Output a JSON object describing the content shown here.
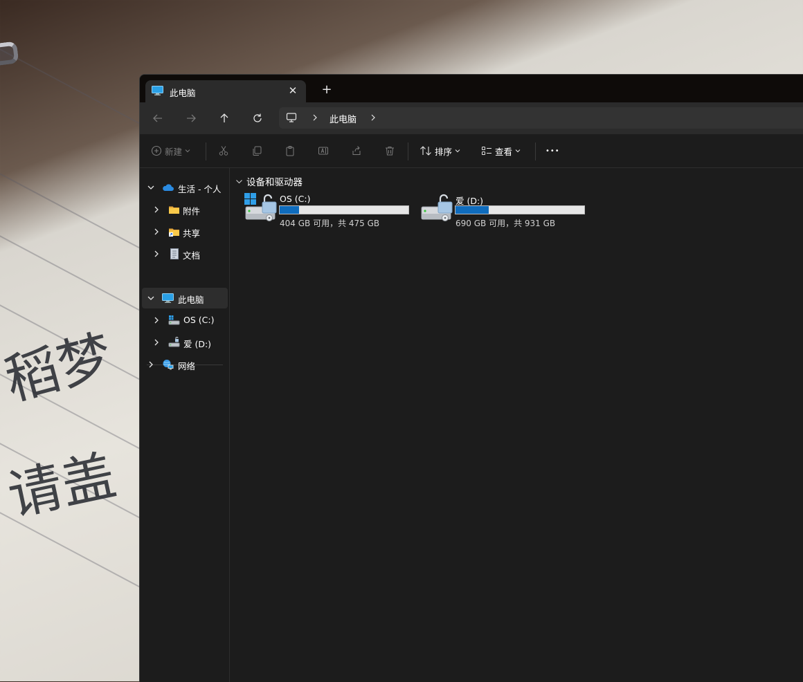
{
  "tab": {
    "title": "此电脑",
    "close_glyph": "✕",
    "new_tab_glyph": "+"
  },
  "nav": {
    "back_icon": "arrow-left-icon",
    "forward_icon": "arrow-right-icon",
    "up_icon": "arrow-up-icon",
    "refresh_icon": "refresh-icon",
    "breadcrumb": [
      "此电脑"
    ]
  },
  "toolbar": {
    "new_label": "新建",
    "sort_label": "排序",
    "view_label": "查看",
    "more_glyph": "•••"
  },
  "sidebar": {
    "items": [
      {
        "label": "生活 - 个人",
        "icon": "onedrive-cloud-icon",
        "expanded": true
      },
      {
        "label": "附件",
        "icon": "folder-icon"
      },
      {
        "label": "共享",
        "icon": "shared-folder-icon"
      },
      {
        "label": "文档",
        "icon": "document-icon"
      },
      {
        "label": "此电脑",
        "icon": "monitor-icon",
        "expanded": true,
        "selected": true
      },
      {
        "label": "OS (C:)",
        "icon": "system-drive-icon"
      },
      {
        "label": "爱 (D:)",
        "icon": "drive-icon"
      },
      {
        "label": "网络",
        "icon": "network-icon"
      }
    ]
  },
  "content": {
    "group_title": "设备和驱动器",
    "drives": [
      {
        "name": "OS (C:)",
        "free_text": "404 GB 可用，共 475 GB",
        "used_fraction": 0.15,
        "icon": "system-drive-locked-icon"
      },
      {
        "name": "爱 (D:)",
        "free_text": "690 GB 可用，共 931 GB",
        "used_fraction": 0.26,
        "icon": "drive-locked-icon"
      }
    ]
  },
  "colors": {
    "accent": "#0f6cbd",
    "window_bg": "#1c1c1c",
    "tab_bg": "#2b2b2b"
  }
}
